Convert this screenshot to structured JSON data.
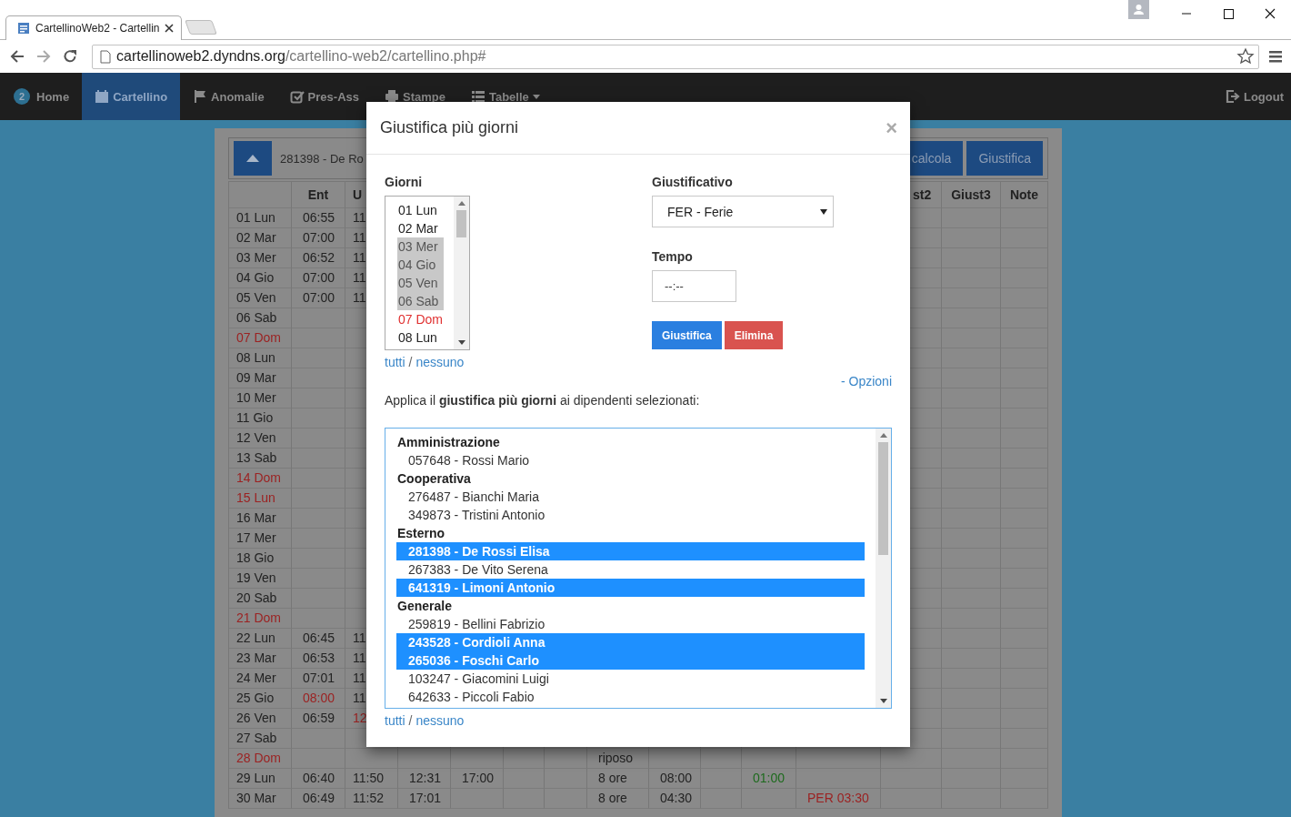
{
  "browser": {
    "tab_title": "CartellinoWeb2 - Cartellin",
    "url_host": "cartellinoweb2.dyndns.org",
    "url_path": "/cartellino-web2/cartellino.php#"
  },
  "navbar": {
    "items": [
      {
        "label": "Home",
        "badge": "2",
        "selected": false
      },
      {
        "label": "Cartellino",
        "kind": "calendar",
        "selected": true
      },
      {
        "label": "Anomalie",
        "kind": "flag",
        "selected": false
      },
      {
        "label": "Pres-Ass",
        "kind": "check",
        "selected": false
      },
      {
        "label": "Stampe",
        "kind": "printer",
        "selected": false
      },
      {
        "label": "Tabelle",
        "kind": "list",
        "dropdown": true,
        "selected": false
      }
    ],
    "logout": "Logout"
  },
  "toolbar": {
    "employee": "281398 - De Ro",
    "buttons": [
      "calcola",
      "Giustifica"
    ]
  },
  "table": {
    "columns": [
      "Ent",
      "U",
      null,
      null,
      null,
      null,
      null,
      null,
      null,
      null,
      null,
      "st2",
      "Giust3",
      "Note"
    ],
    "rows": [
      {
        "day": "01 Lun",
        "holiday": false,
        "cells": [
          "06:55",
          "11"
        ]
      },
      {
        "day": "02 Mar",
        "holiday": false,
        "cells": [
          "07:00",
          "11"
        ]
      },
      {
        "day": "03 Mer",
        "holiday": false,
        "cells": [
          "06:52",
          "11"
        ]
      },
      {
        "day": "04 Gio",
        "holiday": false,
        "cells": [
          "07:00",
          "11"
        ]
      },
      {
        "day": "05 Ven",
        "holiday": false,
        "cells": [
          "07:00",
          "11"
        ]
      },
      {
        "day": "06 Sab",
        "holiday": false,
        "cells": []
      },
      {
        "day": "07 Dom",
        "holiday": true,
        "cells": []
      },
      {
        "day": "08 Lun",
        "holiday": false,
        "cells": []
      },
      {
        "day": "09 Mar",
        "holiday": false,
        "cells": []
      },
      {
        "day": "10 Mer",
        "holiday": false,
        "cells": []
      },
      {
        "day": "11 Gio",
        "holiday": false,
        "cells": []
      },
      {
        "day": "12 Ven",
        "holiday": false,
        "cells": []
      },
      {
        "day": "13 Sab",
        "holiday": false,
        "cells": []
      },
      {
        "day": "14 Dom",
        "holiday": true,
        "cells": []
      },
      {
        "day": "15 Lun",
        "holiday": true,
        "cells": []
      },
      {
        "day": "16 Mar",
        "holiday": false,
        "cells": []
      },
      {
        "day": "17 Mer",
        "holiday": false,
        "cells": []
      },
      {
        "day": "18 Gio",
        "holiday": false,
        "cells": []
      },
      {
        "day": "19 Ven",
        "holiday": false,
        "cells": []
      },
      {
        "day": "20 Sab",
        "holiday": false,
        "cells": []
      },
      {
        "day": "21 Dom",
        "holiday": true,
        "cells": []
      },
      {
        "day": "22 Lun",
        "holiday": false,
        "cells": [
          "06:45",
          "11"
        ]
      },
      {
        "day": "23 Mar",
        "holiday": false,
        "cells": [
          "06:53",
          "11"
        ]
      },
      {
        "day": "24 Mer",
        "holiday": false,
        "cells": [
          "07:01",
          "11"
        ]
      },
      {
        "day": "25 Gio",
        "holiday": false,
        "cells": [
          {
            "text": "08:00",
            "color": "#9b2222"
          },
          "11"
        ]
      },
      {
        "day": "26 Ven",
        "holiday": false,
        "cells": [
          "06:59",
          {
            "text": "12",
            "color": "#9b2222"
          }
        ]
      },
      {
        "day": "27 Sab",
        "holiday": false,
        "cells": []
      },
      {
        "day": "28 Dom",
        "holiday": true,
        "cells": [
          null,
          null,
          null,
          null,
          null,
          null,
          "riposo"
        ]
      },
      {
        "day": "29 Lun",
        "holiday": false,
        "cells": [
          "06:40",
          "11:50",
          "12:31",
          "17:00",
          null,
          null,
          "8 ore",
          "08:00",
          null,
          {
            "text": "01:00",
            "color": "#1d6a1d"
          }
        ]
      },
      {
        "day": "30 Mar",
        "holiday": false,
        "cells": [
          "06:49",
          "11:52",
          "17:01",
          null,
          null,
          null,
          "8 ore",
          "04:30",
          null,
          null,
          {
            "text": "PER 03:30",
            "color": "#9b2222"
          }
        ]
      }
    ]
  },
  "modal": {
    "title": "Giustifica più giorni",
    "close": "×",
    "days": {
      "label": "Giorni",
      "items": [
        {
          "label": "01 Lun",
          "selected": false,
          "holiday": false
        },
        {
          "label": "02 Mar",
          "selected": false,
          "holiday": false
        },
        {
          "label": "03 Mer",
          "selected": true,
          "holiday": false
        },
        {
          "label": "04 Gio",
          "selected": true,
          "holiday": false
        },
        {
          "label": "05 Ven",
          "selected": true,
          "holiday": false
        },
        {
          "label": "06 Sab",
          "selected": true,
          "holiday": false
        },
        {
          "label": "07 Dom",
          "selected": false,
          "holiday": true
        },
        {
          "label": "08 Lun",
          "selected": false,
          "holiday": false
        }
      ],
      "select_all": "tutti",
      "separator": "/",
      "select_none": "nessuno"
    },
    "reason": {
      "label": "Giustificativo",
      "value": "FER - Ferie"
    },
    "time": {
      "label": "Tempo",
      "placeholder": "--:--"
    },
    "buttons": [
      {
        "label": "Giustifica",
        "kind": "primary"
      },
      {
        "label": "Elimina",
        "kind": "danger"
      }
    ],
    "options_link": "- Opzioni",
    "apply_text": "Applica il **giustifica più giorni** ai dipendenti selezionati:",
    "employees": {
      "groups": [
        {
          "label": "Amministrazione",
          "children": [
            {
              "label": "057648 - Rossi Mario",
              "selected": false
            }
          ]
        },
        {
          "label": "Cooperativa",
          "children": [
            {
              "label": "276487 - Bianchi Maria",
              "selected": false
            },
            {
              "label": "349873 - Tristini Antonio",
              "selected": false
            }
          ]
        },
        {
          "label": "Esterno",
          "children": [
            {
              "label": "281398 - De Rossi Elisa",
              "selected": true
            },
            {
              "label": "267383 - De Vito Serena",
              "selected": false
            },
            {
              "label": "641319 - Limoni Antonio",
              "selected": true
            }
          ]
        },
        {
          "label": "Generale",
          "children": [
            {
              "label": "259819 - Bellini Fabrizio",
              "selected": false
            },
            {
              "label": "243528 - Cordioli Anna",
              "selected": true
            },
            {
              "label": "265036 - Foschi Carlo",
              "selected": true
            },
            {
              "label": "103247 - Giacomini Luigi",
              "selected": false
            },
            {
              "label": "642633 - Piccoli Fabio",
              "selected": false
            }
          ]
        }
      ],
      "select_all": "tutti",
      "separator": "/",
      "select_none": "nessuno"
    }
  }
}
